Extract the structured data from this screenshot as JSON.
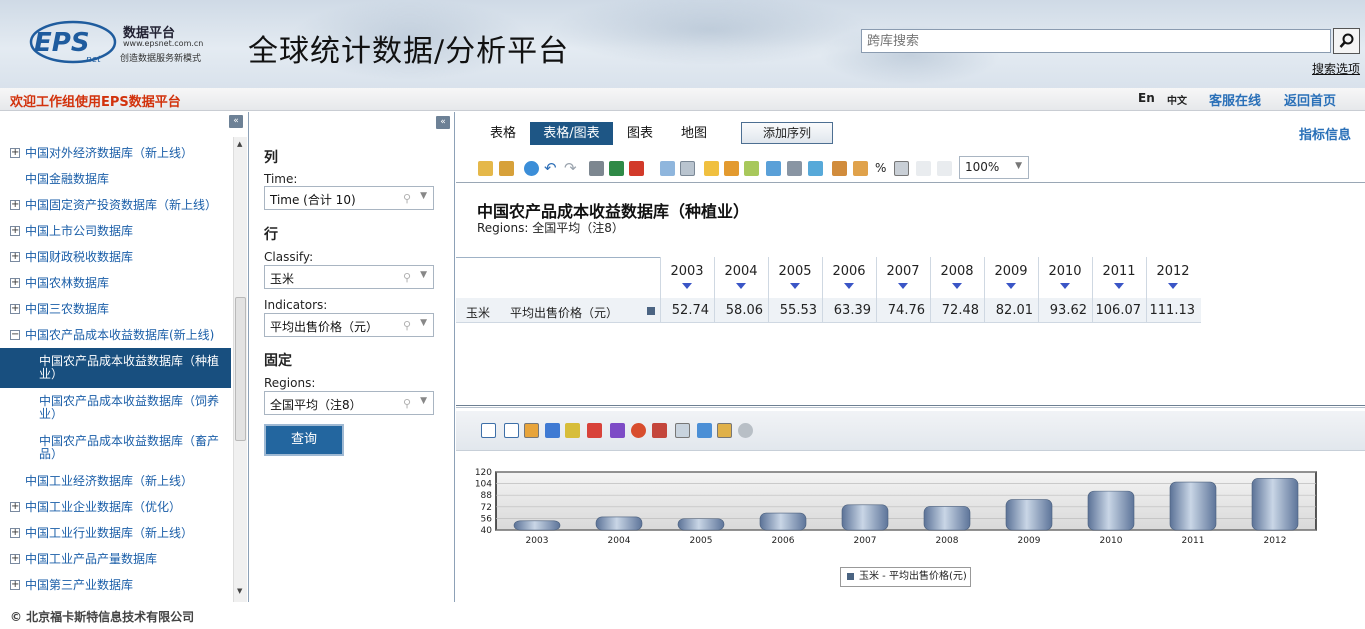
{
  "header": {
    "logo_word": "EPS",
    "logo_net": "net",
    "logo_name": "数据平台",
    "logo_url": "www.epsnet.com.cn",
    "logo_tagline": "创造数据服务新模式",
    "site_title": "全球统计数据/分析平台",
    "search_placeholder": "跨库搜索",
    "search_options": "搜索选项"
  },
  "topbar": {
    "welcome": "欢迎工作组使用EPS数据平台",
    "lang_en": "En",
    "lang_zh": "中文",
    "service": "客服在线",
    "home": "返回首页"
  },
  "tree": {
    "items": [
      {
        "label": "中国对外经济数据库（新上线）",
        "expander": "+"
      },
      {
        "label": "中国金融数据库",
        "expander": ""
      },
      {
        "label": "中国固定资产投资数据库（新上线）",
        "expander": "+"
      },
      {
        "label": "中国上市公司数据库",
        "expander": "+"
      },
      {
        "label": "中国财政税收数据库",
        "expander": "+"
      },
      {
        "label": "中国农林数据库",
        "expander": "+"
      },
      {
        "label": "中国三农数据库",
        "expander": "+"
      },
      {
        "label": "中国农产品成本收益数据库(新上线)",
        "expander": "−"
      },
      {
        "label": "中国农产品成本收益数据库（种植业）",
        "sub": true,
        "selected": true
      },
      {
        "label": "中国农产品成本收益数据库（饲养业）",
        "sub": true
      },
      {
        "label": "中国农产品成本收益数据库（畜产品）",
        "sub": true
      },
      {
        "label": "中国工业经济数据库（新上线）",
        "expander": ""
      },
      {
        "label": "中国工业企业数据库（优化）",
        "expander": "+"
      },
      {
        "label": "中国工业行业数据库（新上线）",
        "expander": "+"
      },
      {
        "label": "中国工业产品产量数据库",
        "expander": "+"
      },
      {
        "label": "中国第三产业数据库",
        "expander": "+"
      }
    ]
  },
  "filters": {
    "col_title": "列",
    "time_label": "Time:",
    "time_value": "Time (合计 10)",
    "row_title": "行",
    "classify_label": "Classify:",
    "classify_value": "玉米",
    "indicators_label": "Indicators:",
    "indicators_value": "平均出售价格（元）",
    "fixed_title": "固定",
    "regions_label": "Regions:",
    "regions_value": "全国平均（注8）",
    "query_button": "查询"
  },
  "main": {
    "tabs": [
      "表格",
      "表格/图表",
      "图表",
      "地图"
    ],
    "active_tab": "表格/图表",
    "add_series": "添加序列",
    "indicator_info": "指标信息",
    "zoom": "100%",
    "percent_symbol": "%",
    "report_title": "中国农产品成本收益数据库（种植业）",
    "report_subtitle": "Regions: 全国平均（注8）",
    "row_label_1": "玉米",
    "row_label_2": "平均出售价格（元）"
  },
  "chart_data": {
    "type": "bar",
    "categories": [
      "2003",
      "2004",
      "2005",
      "2006",
      "2007",
      "2008",
      "2009",
      "2010",
      "2011",
      "2012"
    ],
    "series": [
      {
        "name": "玉米 - 平均出售价格(元)",
        "values": [
          52.74,
          58.06,
          55.53,
          63.39,
          74.76,
          72.48,
          82.01,
          93.62,
          106.07,
          111.13
        ]
      }
    ],
    "value_labels": [
      "52.74",
      "58.06",
      "55.53",
      "63.39",
      "74.76",
      "72.48",
      "82.01",
      "93.62",
      "106.07",
      "111.13"
    ],
    "ylim": [
      40,
      120
    ],
    "yticks": [
      40,
      56,
      72,
      88,
      104,
      120
    ],
    "grid": true,
    "legend_position": "bottom",
    "bar_color": "#8ea3bf",
    "legend_color": "#4b6482"
  },
  "footer": {
    "copyright": "© 北京福卡斯特信息技术有限公司"
  },
  "colors": {
    "accent": "#1e5685",
    "link": "#2a70b8",
    "welcome": "#d2320c"
  }
}
